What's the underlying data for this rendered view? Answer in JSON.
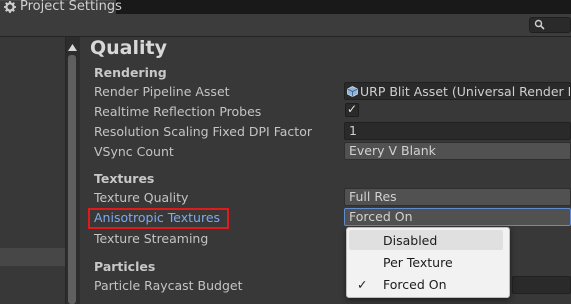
{
  "window": {
    "tab_title": "Project Settings",
    "tab_icon": "gear-icon"
  },
  "toolbar": {
    "search_icon": "search-icon"
  },
  "page": {
    "title": "Quality"
  },
  "rendering": {
    "section_label": "Rendering",
    "rows": [
      {
        "label": "Render Pipeline Asset",
        "value": "URP Blit Asset (Universal Render Pipe"
      },
      {
        "label": "Realtime Reflection Probes",
        "checked": true,
        "value": "✓"
      },
      {
        "label": "Resolution Scaling Fixed DPI Factor",
        "value": "1"
      },
      {
        "label": "VSync Count",
        "value": "Every V Blank"
      }
    ]
  },
  "textures": {
    "section_label": "Textures",
    "rows": [
      {
        "label": "Texture Quality",
        "value": "Full Res"
      },
      {
        "label": "Anisotropic Textures",
        "value": "Forced On"
      },
      {
        "label": "Texture Streaming"
      }
    ]
  },
  "particles": {
    "section_label": "Particles",
    "rows": [
      {
        "label": "Particle Raycast Budget"
      }
    ]
  },
  "popup": {
    "options": [
      {
        "label": "Disabled",
        "selected": false
      },
      {
        "label": "Per Texture",
        "selected": false
      },
      {
        "label": "Forced On",
        "selected": true
      }
    ],
    "check_glyph": "✓"
  },
  "colors": {
    "highlight": "#e01b1b",
    "link": "#7eaaf0",
    "popup_bg": "#f2f2f2"
  }
}
